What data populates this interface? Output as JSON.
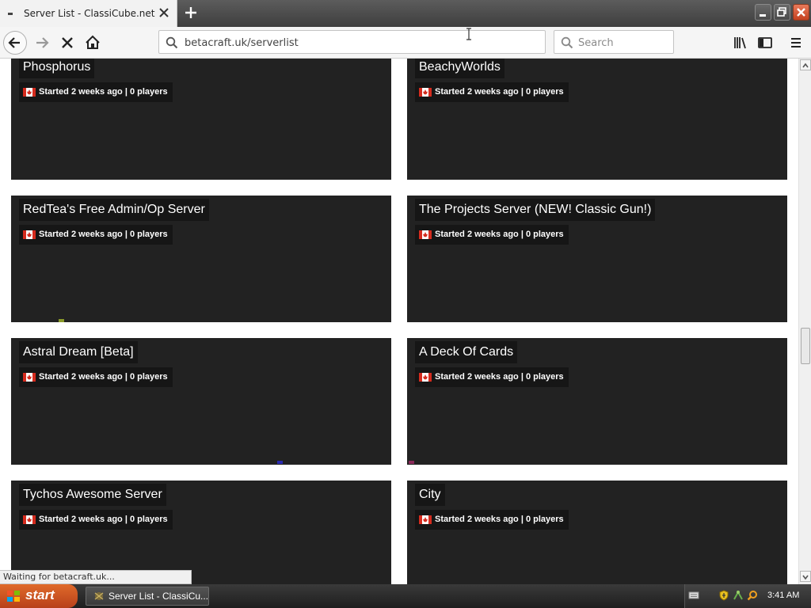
{
  "browser": {
    "tab": {
      "title": "Server List - ClassiCube.net"
    },
    "url": "betacraft.uk/serverlist",
    "search_placeholder": "Search",
    "status": "Waiting for betacraft.uk..."
  },
  "servers": [
    {
      "name": "Phosphorus",
      "info": "Started 2 weeks ago | 0 players"
    },
    {
      "name": "BeachyWorlds",
      "info": "Started 2 weeks ago | 0 players"
    },
    {
      "name": "RedTea's Free Admin/Op Server",
      "info": "Started 2 weeks ago | 0 players"
    },
    {
      "name": "The Projects Server (NEW! Classic Gun!)",
      "info": "Started 2 weeks ago | 0 players"
    },
    {
      "name": "Astral Dream [Beta]",
      "info": "Started 2 weeks ago | 0 players"
    },
    {
      "name": "A Deck Of Cards",
      "info": "Started 2 weeks ago | 0 players"
    },
    {
      "name": "Tychos Awesome Server",
      "info": "Started 2 weeks ago | 0 players"
    },
    {
      "name": "City",
      "info": "Started 2 weeks ago | 0 players"
    }
  ],
  "icons": {
    "flag": "canada-flag-icon",
    "toolbar": [
      "back-icon",
      "forward-icon",
      "stop-icon",
      "home-icon",
      "library-icon",
      "sidebar-icon",
      "menu-icon"
    ]
  },
  "colors": {
    "card_bg": "#222222",
    "label_bg": "#161616",
    "start_button": "#d0552a"
  },
  "taskbar": {
    "start_label": "start",
    "task_label": "Server List - ClassiCu...",
    "clock": "3:41 AM"
  }
}
